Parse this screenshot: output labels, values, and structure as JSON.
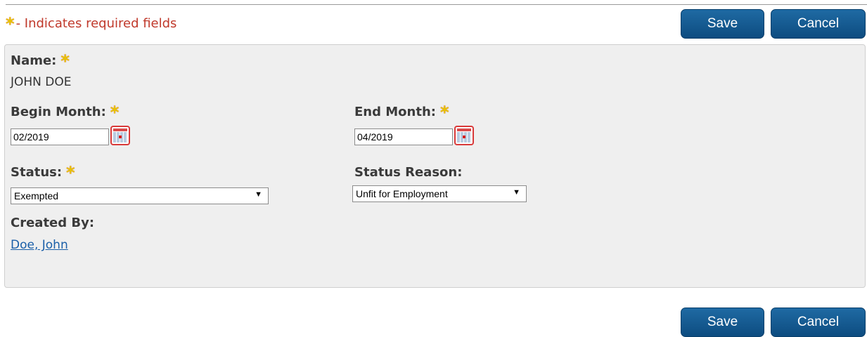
{
  "required_note": {
    "star": "*",
    "text": "- Indicates required fields"
  },
  "buttons": {
    "save": "Save",
    "cancel": "Cancel"
  },
  "form": {
    "name": {
      "label": "Name:",
      "value": "JOHN DOE"
    },
    "begin_month": {
      "label": "Begin Month:",
      "value": "02/2019"
    },
    "end_month": {
      "label": "End Month:",
      "value": "04/2019"
    },
    "status": {
      "label": "Status:",
      "selected": "Exempted"
    },
    "status_reason": {
      "label": "Status Reason:",
      "selected": "Unfit for Employment"
    },
    "created_by": {
      "label": "Created By:",
      "value": "Doe, John"
    }
  },
  "icons": {
    "required": "asterisk-icon",
    "calendar": "calendar-icon",
    "dropdown": "chevron-down-icon"
  },
  "colors": {
    "required_text": "#c0392b",
    "button": "#15598f",
    "link": "#1a5fa8",
    "panel_bg": "#efefef"
  }
}
